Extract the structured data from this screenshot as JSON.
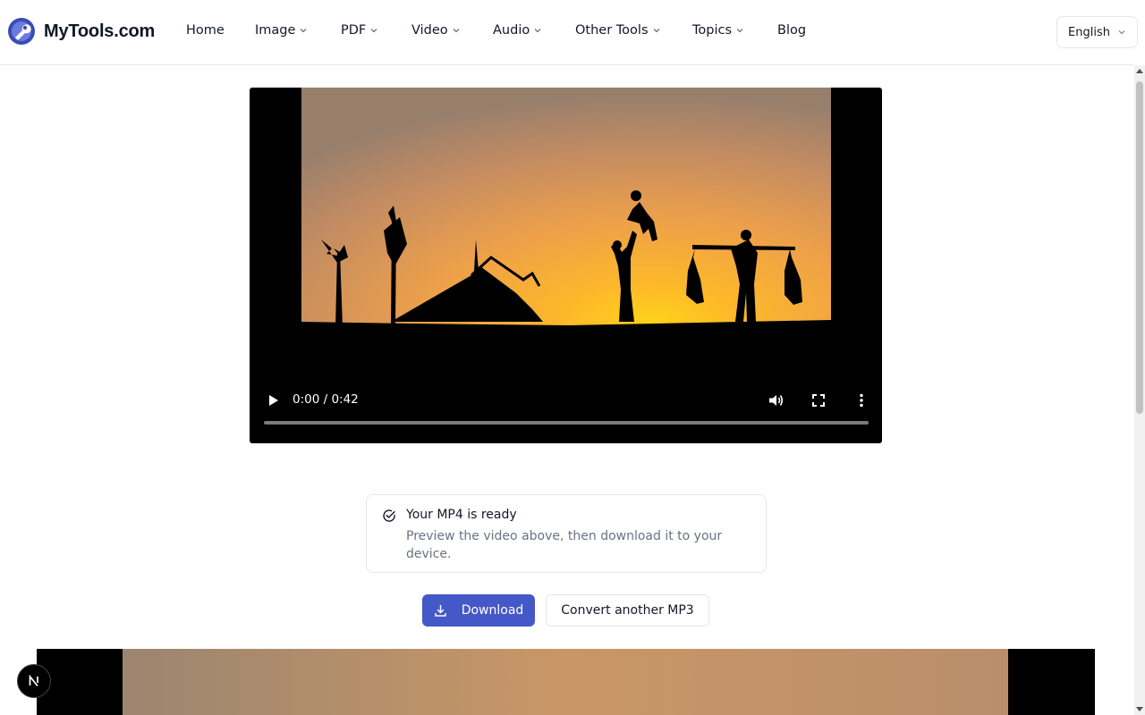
{
  "brand": {
    "name": "MyTools.com",
    "logo_icon": "wrench-globe-icon",
    "accent": "#4558c7"
  },
  "nav": {
    "items": [
      {
        "label": "Home",
        "dropdown": false
      },
      {
        "label": "Image",
        "dropdown": true
      },
      {
        "label": "PDF",
        "dropdown": true
      },
      {
        "label": "Video",
        "dropdown": true
      },
      {
        "label": "Audio",
        "dropdown": true
      },
      {
        "label": "Other Tools",
        "dropdown": true
      },
      {
        "label": "Topics",
        "dropdown": true
      },
      {
        "label": "Blog",
        "dropdown": false
      }
    ]
  },
  "language": {
    "selected": "English"
  },
  "video_player": {
    "current_time": "0:00",
    "duration": "0:42",
    "time_display": "0:00 / 0:42",
    "progress": 0
  },
  "ready_card": {
    "title": "Your MP4 is ready",
    "description": "Preview the video above, then download it to your device."
  },
  "actions": {
    "download_label": "Download",
    "convert_another_label": "Convert another MP3"
  },
  "floating_badge": {
    "label": "N"
  }
}
